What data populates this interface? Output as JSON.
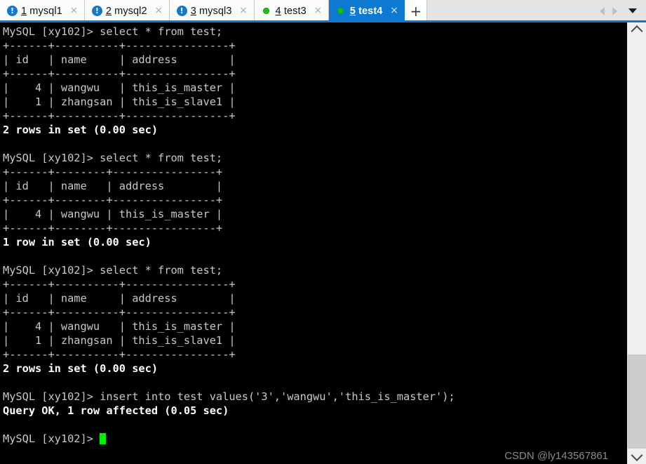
{
  "window": {
    "accent_color": "#0d79d1",
    "tabbar_bg": "#e4e4e4",
    "terminal_bg": "#000000",
    "terminal_fg": "#c8c8c8",
    "cursor_color": "#00ee00"
  },
  "tabbar": {
    "tabs": [
      {
        "number": "1",
        "name": "mysql1",
        "icon": "warning-circle-icon",
        "icon_glyph": "!",
        "active": false,
        "close_glyph": "×"
      },
      {
        "number": "2",
        "name": "mysql2",
        "icon": "warning-circle-icon",
        "icon_glyph": "!",
        "active": false,
        "close_glyph": "×"
      },
      {
        "number": "3",
        "name": "mysql3",
        "icon": "warning-circle-icon",
        "icon_glyph": "!",
        "active": false,
        "close_glyph": "×"
      },
      {
        "number": "4",
        "name": "test3",
        "icon": "green-dot-icon",
        "icon_glyph": "",
        "active": false,
        "close_glyph": "×"
      },
      {
        "number": "5",
        "name": "test4",
        "icon": "green-dot-icon",
        "icon_glyph": "",
        "active": true,
        "close_glyph": "×"
      }
    ],
    "new_tab_label": "+",
    "nav_prev_label": "◀",
    "nav_next_label": "▶",
    "nav_menu_label": "▼"
  },
  "terminal": {
    "prompt": "MySQL [xy102]> ",
    "lines": [
      {
        "text": "MySQL [xy102]> select * from test;",
        "bold": false
      },
      {
        "text": "+------+----------+----------------+",
        "bold": false
      },
      {
        "text": "| id   | name     | address        |",
        "bold": false
      },
      {
        "text": "+------+----------+----------------+",
        "bold": false
      },
      {
        "text": "|    4 | wangwu   | this_is_master |",
        "bold": false
      },
      {
        "text": "|    1 | zhangsan | this_is_slave1 |",
        "bold": false
      },
      {
        "text": "+------+----------+----------------+",
        "bold": false
      },
      {
        "text": "2 rows in set (0.00 sec)",
        "bold": true
      },
      {
        "text": "",
        "bold": false
      },
      {
        "text": "MySQL [xy102]> select * from test;",
        "bold": false
      },
      {
        "text": "+------+--------+----------------+",
        "bold": false
      },
      {
        "text": "| id   | name   | address        |",
        "bold": false
      },
      {
        "text": "+------+--------+----------------+",
        "bold": false
      },
      {
        "text": "|    4 | wangwu | this_is_master |",
        "bold": false
      },
      {
        "text": "+------+--------+----------------+",
        "bold": false
      },
      {
        "text": "1 row in set (0.00 sec)",
        "bold": true
      },
      {
        "text": "",
        "bold": false
      },
      {
        "text": "MySQL [xy102]> select * from test;",
        "bold": false
      },
      {
        "text": "+------+----------+----------------+",
        "bold": false
      },
      {
        "text": "| id   | name     | address        |",
        "bold": false
      },
      {
        "text": "+------+----------+----------------+",
        "bold": false
      },
      {
        "text": "|    4 | wangwu   | this_is_master |",
        "bold": false
      },
      {
        "text": "|    1 | zhangsan | this_is_slave1 |",
        "bold": false
      },
      {
        "text": "+------+----------+----------------+",
        "bold": false
      },
      {
        "text": "2 rows in set (0.00 sec)",
        "bold": true
      },
      {
        "text": "",
        "bold": false
      },
      {
        "text": "MySQL [xy102]> insert into test values('3','wangwu','this_is_master');",
        "bold": false
      },
      {
        "text": "Query OK, 1 row affected (0.05 sec)",
        "bold": true
      },
      {
        "text": "",
        "bold": false
      },
      {
        "text": "MySQL [xy102]> ",
        "bold": false,
        "cursor": true
      }
    ]
  },
  "watermark": {
    "text": "CSDN @ly143567861"
  },
  "scrollbar": {
    "up_label": "▲",
    "down_label": "▼"
  }
}
